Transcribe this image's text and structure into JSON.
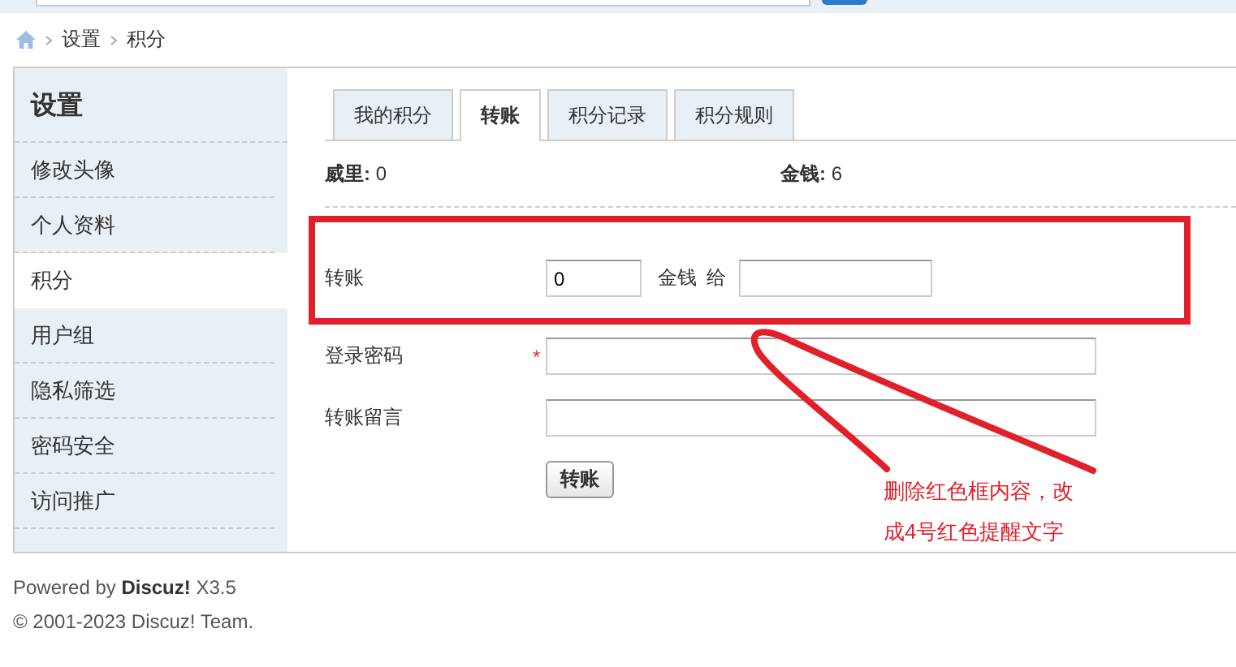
{
  "breadcrumb": {
    "items": [
      "设置",
      "积分"
    ]
  },
  "sidebar": {
    "title": "设置",
    "items": [
      {
        "label": "修改头像",
        "selected": false
      },
      {
        "label": "个人资料",
        "selected": false
      },
      {
        "label": "积分",
        "selected": true
      },
      {
        "label": "用户组",
        "selected": false
      },
      {
        "label": "隐私筛选",
        "selected": false
      },
      {
        "label": "密码安全",
        "selected": false
      },
      {
        "label": "访问推广",
        "selected": false
      }
    ]
  },
  "tabs": [
    {
      "label": "我的积分",
      "selected": false
    },
    {
      "label": "转账",
      "selected": true
    },
    {
      "label": "积分记录",
      "selected": false
    },
    {
      "label": "积分规则",
      "selected": false
    }
  ],
  "stats": [
    {
      "label": "威里:",
      "value": "0"
    },
    {
      "label": "金钱:",
      "value": "6"
    }
  ],
  "form": {
    "transfer": {
      "label": "转账",
      "amount": "0",
      "unit": "金钱",
      "to": "给"
    },
    "password": {
      "label": "登录密码",
      "required_mark": "*"
    },
    "message": {
      "label": "转账留言"
    },
    "submit": "转账"
  },
  "annotation": {
    "lines": [
      "删除红色框内容，改",
      "成4号红色提醒文字"
    ]
  },
  "footer": {
    "powered": "Powered by **Discuz!** X3.5",
    "copyright": "© 2001-2023 Discuz! Team."
  }
}
